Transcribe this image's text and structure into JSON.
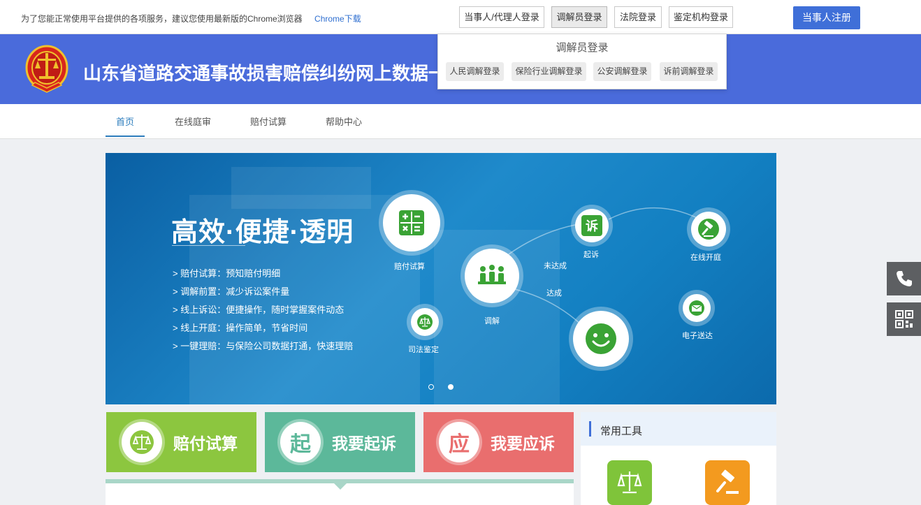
{
  "topbar": {
    "notice": "为了您能正常使用平台提供的各项服务，建议您使用最新版的Chrome浏览器",
    "chrome_link": "Chrome下载",
    "logins": [
      {
        "label": "当事人/代理人登录"
      },
      {
        "label": "调解员登录"
      },
      {
        "label": "法院登录"
      },
      {
        "label": "鉴定机构登录"
      }
    ],
    "register": "当事人注册"
  },
  "header": {
    "site_title": "山东省道路交通事故损害赔偿纠纷网上数据一体化处理平台"
  },
  "dropdown": {
    "title": "调解员登录",
    "options": [
      "人民调解登录",
      "保险行业调解登录",
      "公安调解登录",
      "诉前调解登录"
    ]
  },
  "nav": {
    "items": [
      "首页",
      "在线庭审",
      "赔付试算",
      "帮助中心"
    ]
  },
  "banner": {
    "slogan": "高效·便捷·透明",
    "features": [
      "> 赔付试算：预知赔付明细",
      "> 调解前置：减少诉讼案件量",
      "> 线上诉讼：便捷操作，随时掌握案件动态",
      "> 线上开庭：操作简单，节省时间",
      "> 一键理赔：与保险公司数据打通，快速理赔"
    ],
    "flow": {
      "calc": "赔付试算",
      "mediation": "调解",
      "judicial": "司法鉴定",
      "not_reached": "未达成",
      "reached": "达成",
      "sue": "起诉",
      "sue_glyph": "诉",
      "online_court": "在线开庭",
      "e_delivery": "电子送达"
    }
  },
  "tiles": [
    {
      "glyph": "",
      "label": "赔付试算",
      "color": "#8cc63f"
    },
    {
      "glyph": "起",
      "label": "我要起诉",
      "color": "#5cb89a"
    },
    {
      "glyph": "应",
      "label": "我要应诉",
      "color": "#e96e6e"
    }
  ],
  "tools": {
    "title": "常用工具"
  },
  "colors": {
    "brand_blue": "#4a6bdb",
    "nav_active": "#2d7dbd",
    "green": "#8cc63f",
    "teal": "#5cb89a",
    "red": "#e96e6e",
    "orange": "#f39a1f"
  },
  "icons": [
    "court-emblem-icon",
    "calculator-icon",
    "team-icon",
    "scales-icon",
    "smile-icon",
    "gavel-icon",
    "mail-icon",
    "phone-icon",
    "qrcode-icon"
  ]
}
